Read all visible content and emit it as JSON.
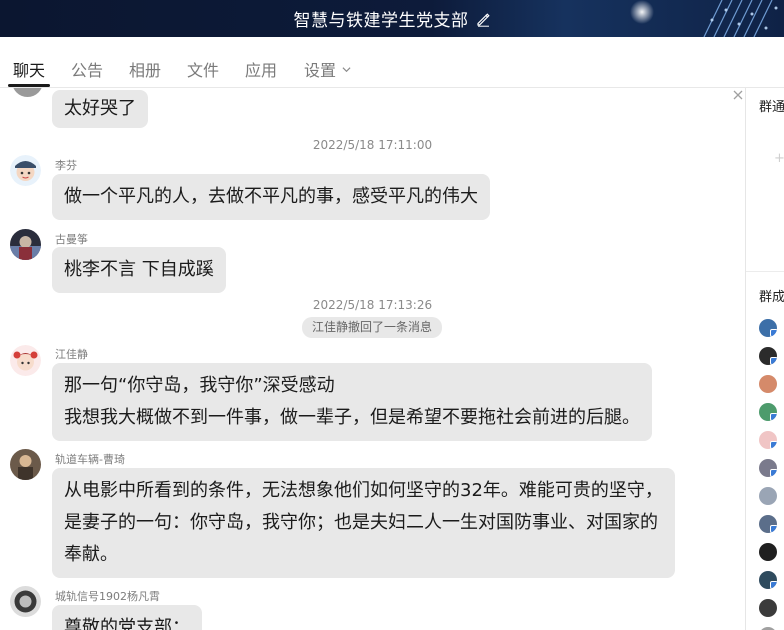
{
  "window": {
    "title": "智慧与铁建学生党支部"
  },
  "tabs": [
    {
      "label": "聊天"
    },
    {
      "label": "公告"
    },
    {
      "label": "相册"
    },
    {
      "label": "文件"
    },
    {
      "label": "应用"
    },
    {
      "label": "设置"
    }
  ],
  "chat": {
    "msg0": {
      "lines": [
        "太好哭了"
      ]
    },
    "ts1": "2022/5/18 17:11:00",
    "msg1": {
      "sender": "李芬",
      "lines": [
        "做一个平凡的人，去做不平凡的事，感受平凡的伟大"
      ]
    },
    "msg2": {
      "sender": "古曼筝",
      "lines": [
        "桃李不言 下自成蹊"
      ]
    },
    "ts2": "2022/5/18 17:13:26",
    "recall": "江佳静撤回了一条消息",
    "msg3": {
      "sender": "江佳静",
      "lines": [
        "那一句“你守岛，我守你”深受感动",
        "我想我大概做不到一件事，做一辈子，但是希望不要拖社会前进的后腿。"
      ]
    },
    "msg4": {
      "sender": "轨道车辆-曹琦",
      "lines": [
        "从电影中所看到的条件，无法想象他们如何坚守的32年。难能可贵的坚守，",
        "是妻子的一句：你守岛，我守你；也是夫妇二人一生对国防事业、对国家的",
        "奉献。"
      ]
    },
    "msg5": {
      "sender": "城轨信号1902杨凡霄",
      "lines": [
        "尊敬的党支部："
      ]
    }
  },
  "sidebar": {
    "notice_label": "群通",
    "members_label": "群成",
    "add_icon": "plus-icon"
  }
}
